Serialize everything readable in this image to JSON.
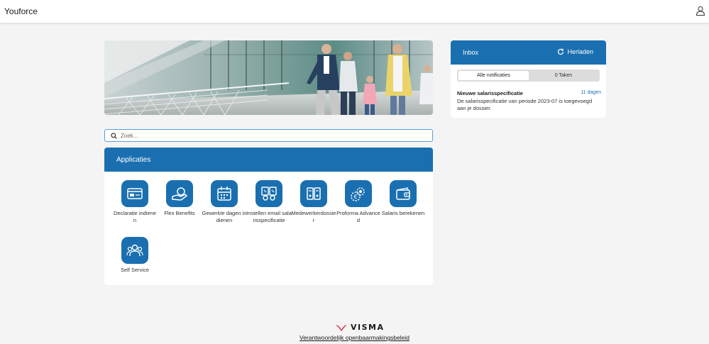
{
  "header": {
    "app_title": "Youforce",
    "user_icon": "user-icon"
  },
  "search": {
    "placeholder": "Zoek..."
  },
  "applications": {
    "title": "Applicaties",
    "tiles": [
      {
        "label": "Declaratie indienen",
        "icon": "credit-card-icon"
      },
      {
        "label": "Flex Benefits",
        "icon": "hand-coin-icon"
      },
      {
        "label": "Gewerkte dagen indienen",
        "icon": "calendar-icon"
      },
      {
        "label": "Instellen email salarisspecificatie",
        "icon": "email-settings-icon"
      },
      {
        "label": "Medewerkerdossier",
        "icon": "files-icon"
      },
      {
        "label": "Proforma Advanced",
        "icon": "euro-gear-icon"
      },
      {
        "label": "Salaris berekenen",
        "icon": "wallet-icon"
      },
      {
        "label": "Self Service",
        "icon": "people-icon"
      }
    ]
  },
  "inbox": {
    "title": "Inbox",
    "reload_label": "Herladen",
    "tabs": [
      {
        "label": "Alle notificaties",
        "active": true
      },
      {
        "label": "0 Taken",
        "active": false
      }
    ],
    "messages": [
      {
        "title": "Nieuwe salarisspecificatie",
        "age": "11 dagen",
        "body": "De salarisspecificatie van periode 2023-07 is toegevoegd aan je dossier."
      }
    ]
  },
  "footer": {
    "brand": "VISMA",
    "link_label": "Verantwoordelijk openbaarmakingsbeleid"
  },
  "colors": {
    "primary_blue": "#1a6fb0",
    "visma_red": "#e0203a",
    "page_bg": "#f4f4f4"
  }
}
